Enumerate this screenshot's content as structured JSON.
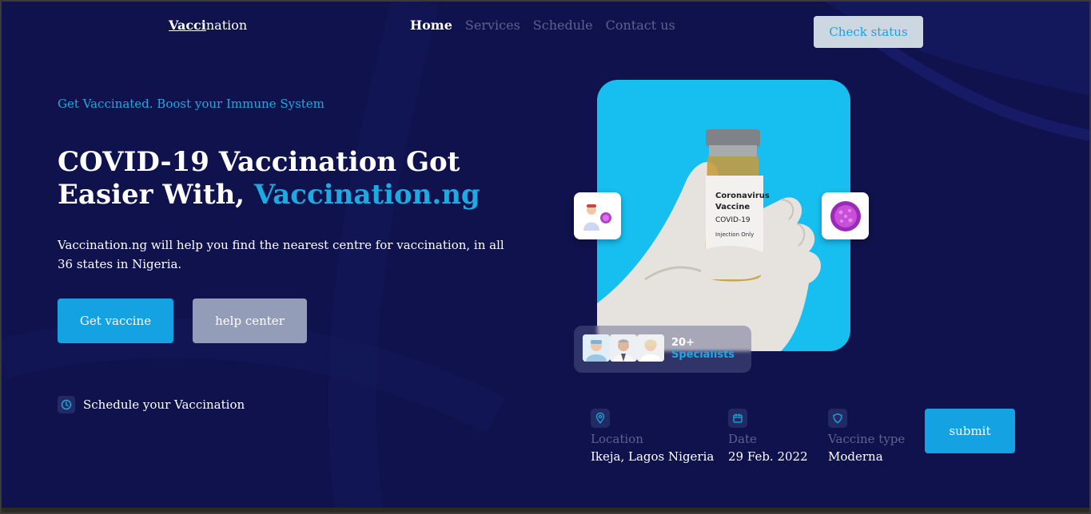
{
  "nav": {
    "logo_underlined": "Vacci",
    "logo_rest": "nation",
    "items": [
      {
        "label": "Home",
        "active": true
      },
      {
        "label": "Services",
        "active": false
      },
      {
        "label": "Schedule",
        "active": false
      },
      {
        "label": "Contact us",
        "active": false
      }
    ],
    "cta_label": "Check status"
  },
  "hero": {
    "tagline": "Get Vaccinated. Boost your Immune System",
    "headline_part1": "COVID-19 Vaccination Got Easier With, ",
    "headline_accent": "Vaccination.ng",
    "description": "Vaccination.ng will help you find the nearest centre for vaccination, in all 36 states in Nigeria.",
    "primary_button": "Get vaccine",
    "secondary_button": "help center",
    "schedule_link": "Schedule your Vaccination"
  },
  "image_card": {
    "vial_label_line1": "Coronavirus",
    "vial_label_line2": "Vaccine",
    "vial_label_line3": "COVID-19",
    "vial_label_line4": "Injection Only",
    "specialists_count": "20+",
    "specialists_label": "Specialists"
  },
  "booking": {
    "location_label": "Location",
    "location_value": "Ikeja, Lagos Nigeria",
    "date_label": "Date",
    "date_value": "29 Feb. 2022",
    "type_label": "Vaccine type",
    "type_value": "Moderna",
    "submit_label": "submit"
  },
  "colors": {
    "background": "#10124d",
    "accent": "#1ea9e1",
    "primary_button": "#14a2e3",
    "secondary_button": "#939db7",
    "card": "#16bff0"
  },
  "icons": {
    "schedule": "clock-icon",
    "location": "map-pin-icon",
    "date": "calendar-icon",
    "vaccine_type": "shield-icon"
  }
}
